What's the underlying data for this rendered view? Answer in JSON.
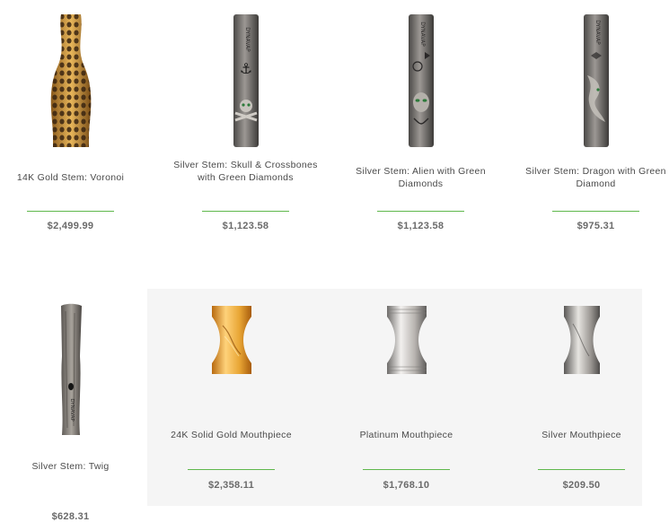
{
  "products": {
    "row1": [
      {
        "name": "14K Gold Stem: Voronoi",
        "price": "$2,499.99",
        "image": "gold-voronoi-stem-image"
      },
      {
        "name": "Silver Stem: Skull & Crossbones with Green Diamonds",
        "price": "$1,123.58",
        "image": "silver-skull-stem-image"
      },
      {
        "name": "Silver Stem: Alien with Green Diamonds",
        "price": "$1,123.58",
        "image": "silver-alien-stem-image"
      },
      {
        "name": "Silver Stem: Dragon with Green Diamond",
        "price": "$975.31",
        "image": "silver-dragon-stem-image"
      }
    ],
    "row2": [
      {
        "name": "Silver Stem: Twig",
        "price": "$628.31",
        "image": "silver-twig-stem-image"
      },
      {
        "name": "24K Solid Gold Mouthpiece",
        "price": "$2,358.11",
        "image": "gold-mouthpiece-image"
      },
      {
        "name": "Platinum Mouthpiece",
        "price": "$1,768.10",
        "image": "platinum-mouthpiece-image"
      },
      {
        "name": "Silver Mouthpiece",
        "price": "$209.50",
        "image": "silver-mouthpiece-image"
      }
    ]
  },
  "colors": {
    "accent_rule": "#5fb84c",
    "panel_bg": "#f5f5f5",
    "name_text": "#4a4a4a",
    "price_text": "#6a6a6a"
  }
}
